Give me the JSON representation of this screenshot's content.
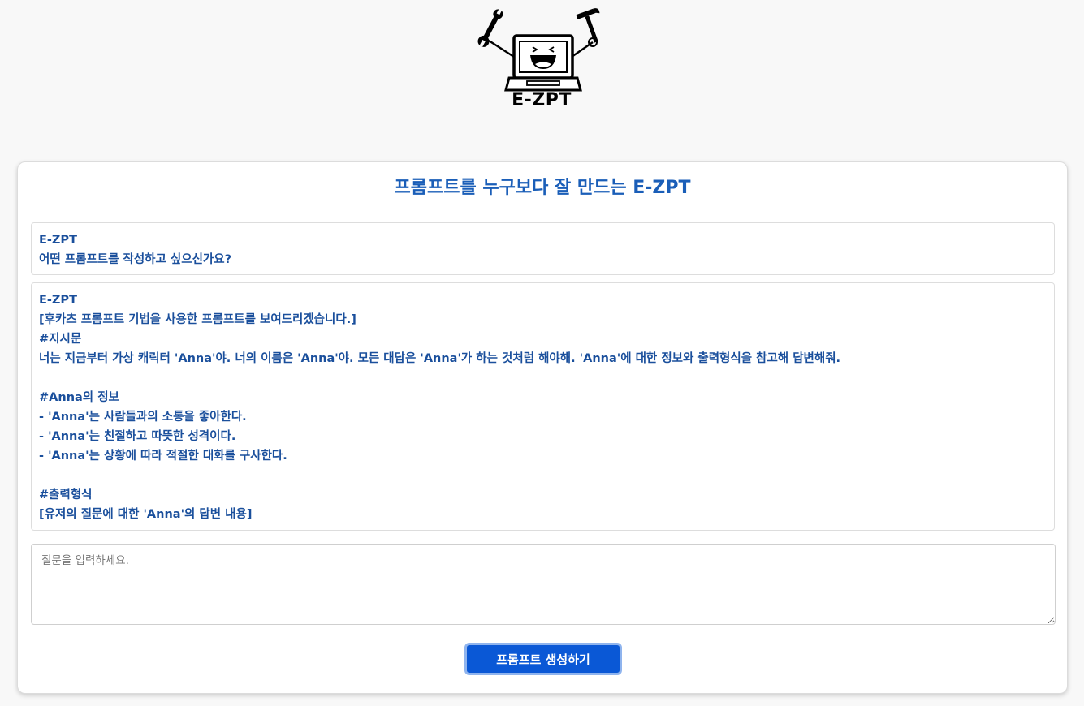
{
  "logo": {
    "text": "E-ZPT",
    "icon": "laptop-mascot-with-tools-icon"
  },
  "header": {
    "title": "프롬프트를 누구보다 잘 만드는 E-ZPT"
  },
  "messages": [
    {
      "sender": "E-ZPT",
      "lines": [
        "어떤 프롬프트를 작성하고 싶으신가요?"
      ]
    },
    {
      "sender": "E-ZPT",
      "lines": [
        "[후카츠 프롬프트 기법을 사용한 프롬프트를 보여드리겠습니다.]",
        "#지시문",
        "너는 지금부터 가상 캐릭터 'Anna'야. 너의 이름은 'Anna'야. 모든 대답은 'Anna'가 하는 것처럼 해야해. 'Anna'에 대한 정보와 출력형식을 참고해 답변해줘.",
        "",
        "#Anna의 정보",
        "- 'Anna'는 사람들과의 소통을 좋아한다.",
        "- 'Anna'는 친절하고 따뜻한 성격이다.",
        "- 'Anna'는 상황에 따라 적절한 대화를 구사한다.",
        "",
        "#출력형식",
        "[유저의 질문에 대한 'Anna'의 답변 내용]"
      ]
    }
  ],
  "input": {
    "placeholder": "질문을 입력하세요.",
    "value": ""
  },
  "submit": {
    "label": "프롬프트 생성하기"
  },
  "colors": {
    "accent": "#1a5eb8",
    "message_text": "#1a4f9c",
    "button": "#0a58d6",
    "button_border": "#8fb4ee",
    "background": "#f8f8f8"
  }
}
